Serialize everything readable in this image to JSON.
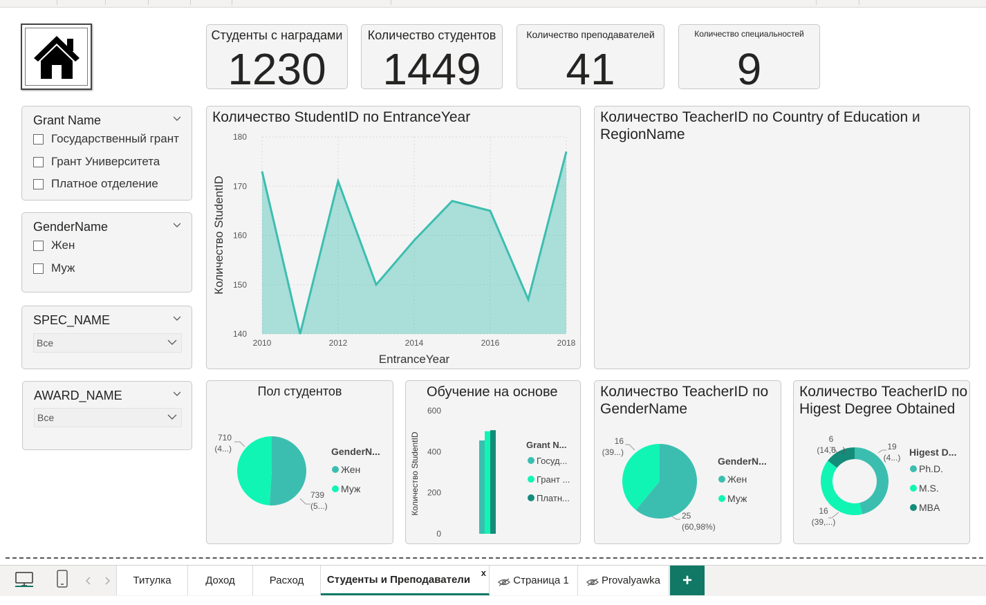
{
  "kpis": [
    {
      "label": "Студенты с наградами",
      "value": "1230"
    },
    {
      "label": "Количество студентов",
      "value": "1449"
    },
    {
      "label": "Количество преподавателей",
      "value": "41"
    },
    {
      "label": "Количество специальностей",
      "value": "9"
    }
  ],
  "slicers": {
    "grant": {
      "title": "Grant Name",
      "items": [
        "Государственный грант",
        "Грант Университета",
        "Платное отделение"
      ]
    },
    "gender": {
      "title": "GenderName",
      "items": [
        "Жен",
        "Муж"
      ]
    },
    "spec": {
      "title": "SPEC_NAME",
      "selected": "Все"
    },
    "award": {
      "title": "AWARD_NAME",
      "selected": "Все"
    }
  },
  "visuals": {
    "area_title": "Количество StudentID по EntranceYear",
    "map_title": "Количество TeacherID по Country of Education и RegionName",
    "gender_pie_title": "Пол студентов",
    "basis_title": "Обучение на основе",
    "teacher_gender_title": "Количество TeacherID по GenderName",
    "degree_title": "Количество TeacherID по Higest Degree Obtained"
  },
  "chart_data": [
    {
      "type": "area",
      "title": "Количество StudentID по EntranceYear",
      "xlabel": "EntranceYear",
      "ylabel": "Количество StudentID",
      "x": [
        2010,
        2011,
        2012,
        2013,
        2014,
        2015,
        2016,
        2017,
        2018
      ],
      "values": [
        173,
        140,
        171,
        150,
        159,
        167,
        165,
        147,
        177
      ],
      "xticks": [
        "2010",
        "2012",
        "2014",
        "2016",
        "2018"
      ],
      "yticks": [
        "140",
        "150",
        "160",
        "170",
        "180"
      ],
      "ylim": [
        140,
        180
      ],
      "color": "#3bbeb0",
      "grid": true
    },
    {
      "type": "pie",
      "title": "Пол студентов",
      "legend_title": "GenderN...",
      "slices": [
        {
          "name": "Жен",
          "value": 739,
          "label": "739",
          "sublabel": "(5...)",
          "color": "#3bbeb0"
        },
        {
          "name": "Муж",
          "value": 710,
          "label": "710",
          "sublabel": "(4...)",
          "color": "#11f5b4"
        }
      ]
    },
    {
      "type": "bar",
      "title": "Обучение на основе",
      "ylabel": "Количество StudentID",
      "legend_title": "Grant N...",
      "yticks": [
        "0",
        "200",
        "400",
        "600"
      ],
      "ylim": [
        0,
        600
      ],
      "series": [
        {
          "name": "Госуд...",
          "value": 455,
          "color": "#3bbeb0"
        },
        {
          "name": "Грант ...",
          "value": 500,
          "color": "#11f5b4"
        },
        {
          "name": "Платн...",
          "value": 505,
          "color": "#158c7a"
        }
      ]
    },
    {
      "type": "pie",
      "title": "Количество TeacherID по GenderName",
      "legend_title": "GenderN...",
      "slices": [
        {
          "name": "Жен",
          "value": 25,
          "label": "25",
          "sublabel": "(60,98%)",
          "color": "#3bbeb0"
        },
        {
          "name": "Муж",
          "value": 16,
          "label": "16",
          "sublabel": "(39...)",
          "color": "#11f5b4"
        }
      ]
    },
    {
      "type": "donut",
      "title": "Количество TeacherID по Higest Degree Obtained",
      "legend_title": "Higest D...",
      "slices": [
        {
          "name": "Ph.D.",
          "value": 19,
          "label": "19",
          "sublabel": "(4...)",
          "color": "#3bbeb0"
        },
        {
          "name": "M.S.",
          "value": 16,
          "label": "16",
          "sublabel": "(39,...)",
          "color": "#11f5b4"
        },
        {
          "name": "MBA",
          "value": 6,
          "label": "6",
          "sublabel": "(14,6...)",
          "color": "#158c7a"
        }
      ]
    }
  ],
  "tabs": [
    {
      "label": "Титулка",
      "active": false
    },
    {
      "label": "Доход",
      "active": false
    },
    {
      "label": "Расход",
      "active": false
    },
    {
      "label": "Студенты и Преподаватели",
      "active": true
    },
    {
      "label": "Страница 1",
      "active": false,
      "hidden": true
    },
    {
      "label": "Provalyawka",
      "active": false,
      "hidden": true
    }
  ],
  "close_tab": "x",
  "add_tab": "+",
  "accent": "#117865"
}
